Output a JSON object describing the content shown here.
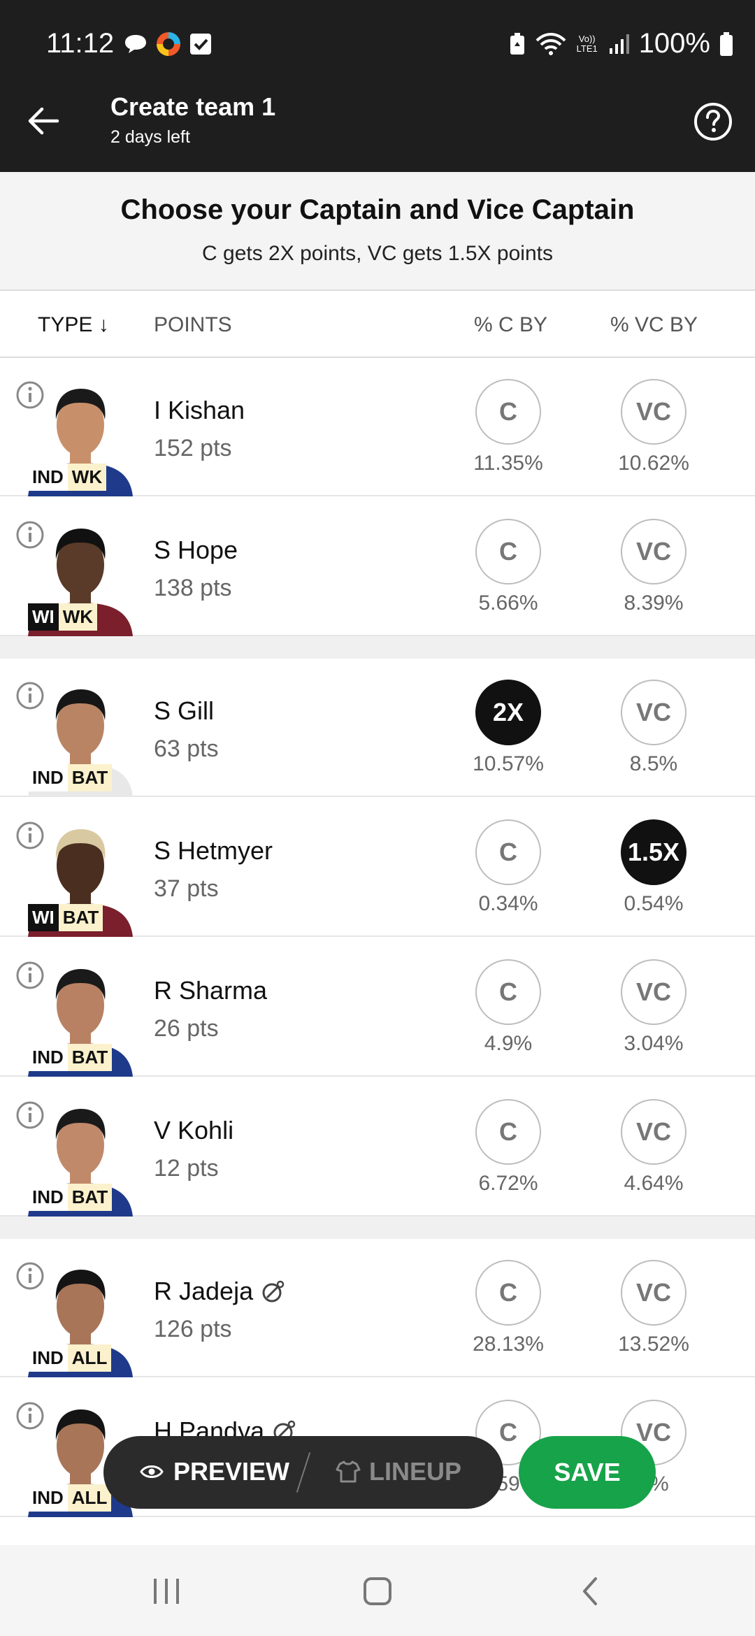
{
  "status_bar": {
    "time": "11:12",
    "battery": "100%",
    "network_label": "Vo)) LTE1"
  },
  "header": {
    "title": "Create team 1",
    "subtitle": "2 days left"
  },
  "banner": {
    "title": "Choose your Captain and Vice Captain",
    "subtitle": "C gets 2X points, VC gets 1.5X points"
  },
  "columns": {
    "type": "TYPE ↓",
    "points": "POINTS",
    "c_by": "% C BY",
    "vc_by": "% VC BY"
  },
  "players": [
    {
      "name": "I Kishan",
      "points": "152 pts",
      "team": "IND",
      "role": "WK",
      "c_label": "C",
      "vc_label": "VC",
      "c_pct": "11.35%",
      "vc_pct": "10.62%",
      "c_selected": false,
      "vc_selected": false,
      "badge": false,
      "jersey": "#1f3a8a",
      "skin": "#c8906a",
      "hair": "#1a1a1a"
    },
    {
      "name": "S Hope",
      "points": "138 pts",
      "team": "WI",
      "role": "WK",
      "c_label": "C",
      "vc_label": "VC",
      "c_pct": "5.66%",
      "vc_pct": "8.39%",
      "c_selected": false,
      "vc_selected": false,
      "badge": false,
      "jersey": "#7a1f2b",
      "skin": "#5a3a28",
      "hair": "#111111"
    },
    {
      "name": "S Gill",
      "points": "63 pts",
      "team": "IND",
      "role": "BAT",
      "c_label": "2X",
      "vc_label": "VC",
      "c_pct": "10.57%",
      "vc_pct": "8.5%",
      "c_selected": true,
      "vc_selected": false,
      "badge": false,
      "jersey": "#e8e8e8",
      "skin": "#b98463",
      "hair": "#161616"
    },
    {
      "name": "S Hetmyer",
      "points": "37 pts",
      "team": "WI",
      "role": "BAT",
      "c_label": "C",
      "vc_label": "1.5X",
      "c_pct": "0.34%",
      "vc_pct": "0.54%",
      "c_selected": false,
      "vc_selected": true,
      "badge": false,
      "jersey": "#7a1f2b",
      "skin": "#4a2e20",
      "hair": "#d9c9a0"
    },
    {
      "name": "R Sharma",
      "points": "26 pts",
      "team": "IND",
      "role": "BAT",
      "c_label": "C",
      "vc_label": "VC",
      "c_pct": "4.9%",
      "vc_pct": "3.04%",
      "c_selected": false,
      "vc_selected": false,
      "badge": false,
      "jersey": "#1f3a8a",
      "skin": "#b88163",
      "hair": "#1a1a1a"
    },
    {
      "name": "V Kohli",
      "points": "12 pts",
      "team": "IND",
      "role": "BAT",
      "c_label": "C",
      "vc_label": "VC",
      "c_pct": "6.72%",
      "vc_pct": "4.64%",
      "c_selected": false,
      "vc_selected": false,
      "badge": false,
      "jersey": "#1f3a8a",
      "skin": "#c0896a",
      "hair": "#1a1a1a"
    },
    {
      "name": "R Jadeja",
      "points": "126 pts",
      "team": "IND",
      "role": "ALL",
      "c_label": "C",
      "vc_label": "VC",
      "c_pct": "28.13%",
      "vc_pct": "13.52%",
      "c_selected": false,
      "vc_selected": false,
      "badge": true,
      "jersey": "#1f3a8a",
      "skin": "#a87558",
      "hair": "#141414"
    },
    {
      "name": "H Pandya",
      "points": "",
      "team": "IND",
      "role": "ALL",
      "c_label": "C",
      "vc_label": "VC",
      "c_pct": "59",
      "vc_pct": "7%",
      "c_selected": false,
      "vc_selected": false,
      "badge": true,
      "jersey": "#1f3a8a",
      "skin": "#a87558",
      "hair": "#141414"
    }
  ],
  "actions": {
    "preview": "PREVIEW",
    "lineup": "LINEUP",
    "save": "SAVE"
  },
  "colors": {
    "header_bg": "#1e1e1e",
    "save_green": "#17a34a",
    "selected_black": "#111111"
  }
}
